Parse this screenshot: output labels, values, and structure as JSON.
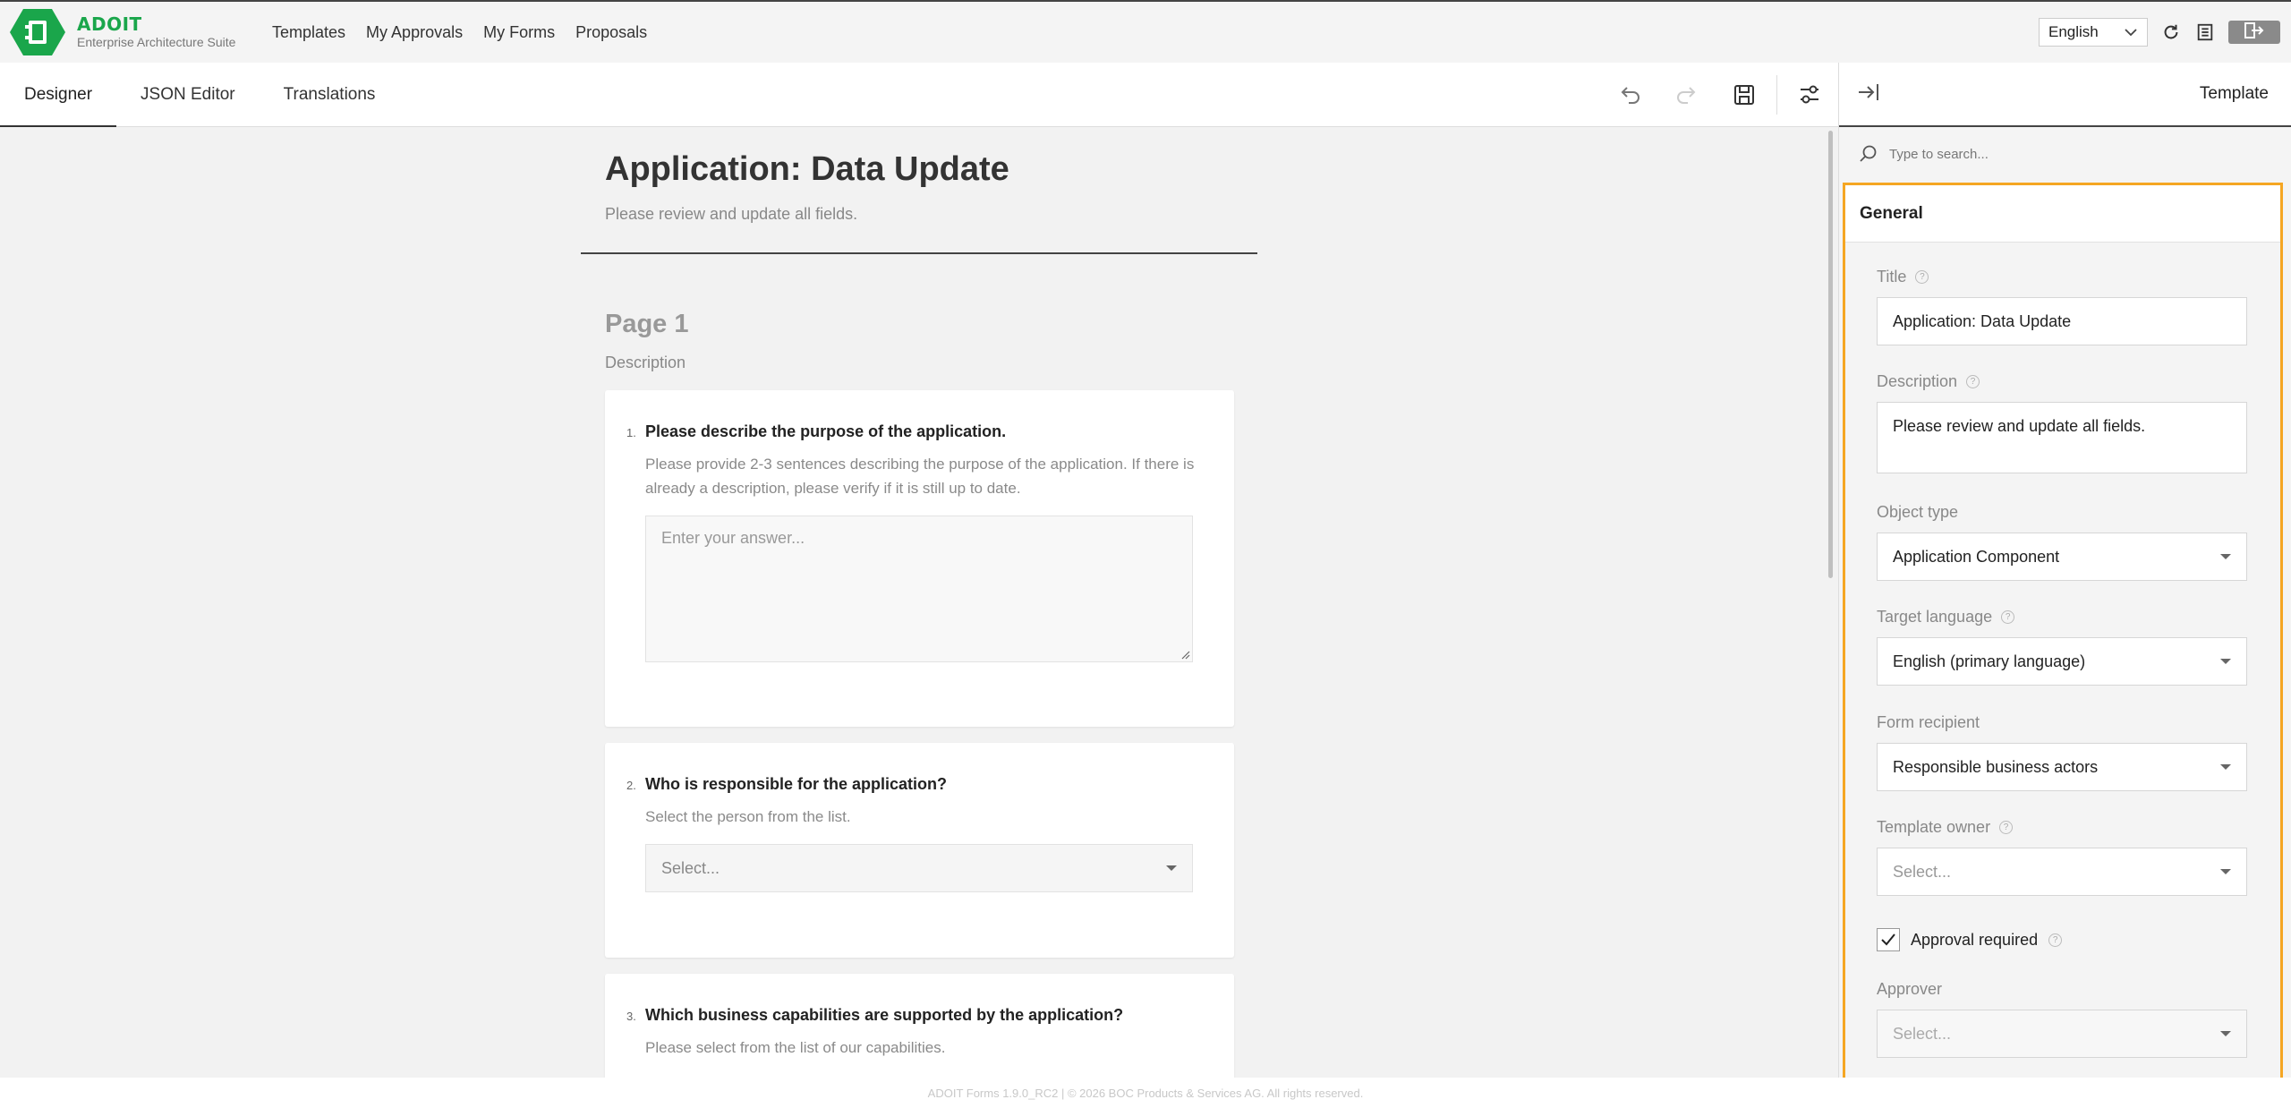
{
  "app": {
    "brand": "ADOIT",
    "subtitle": "Enterprise Architecture Suite"
  },
  "nav": {
    "items": [
      "Templates",
      "My Approvals",
      "My Forms",
      "Proposals"
    ]
  },
  "top_right": {
    "language": "English"
  },
  "tabs": [
    "Designer",
    "JSON Editor",
    "Translations"
  ],
  "form": {
    "title": "Application: Data Update",
    "description": "Please review and update all fields.",
    "page_title": "Page 1",
    "page_description": "Description",
    "questions": [
      {
        "number": "1.",
        "title": "Please describe the purpose of the application.",
        "description": "Please provide 2-3 sentences describing the purpose of the application. If there is already a description, please verify if it is still up to date.",
        "placeholder": "Enter your answer..."
      },
      {
        "number": "2.",
        "title": "Who is responsible for the application?",
        "description": "Select the person from the list.",
        "placeholder": "Select..."
      },
      {
        "number": "3.",
        "title": "Which business capabilities are supported by the application?",
        "description": "Please select from the list of our capabilities."
      }
    ]
  },
  "panel": {
    "header": "Template",
    "search_placeholder": "Type to search...",
    "section": "General",
    "fields": {
      "title_label": "Title",
      "title_value": "Application: Data Update",
      "description_label": "Description",
      "description_value": "Please review and update all fields.",
      "object_type_label": "Object type",
      "object_type_value": "Application Component",
      "target_language_label": "Target language",
      "target_language_value": "English (primary language)",
      "form_recipient_label": "Form recipient",
      "form_recipient_value": "Responsible business actors",
      "template_owner_label": "Template owner",
      "template_owner_value": "Select...",
      "approval_label": "Approval required",
      "approval_checked": true,
      "approver_label": "Approver",
      "approver_value": "Select..."
    }
  },
  "footer": {
    "text": "ADOIT Forms 1.9.0_RC2 | © 2026 BOC Products & Services AG. All rights reserved."
  },
  "colors": {
    "brand_green": "#1aa64b",
    "section_highlight": "#f5a623"
  }
}
